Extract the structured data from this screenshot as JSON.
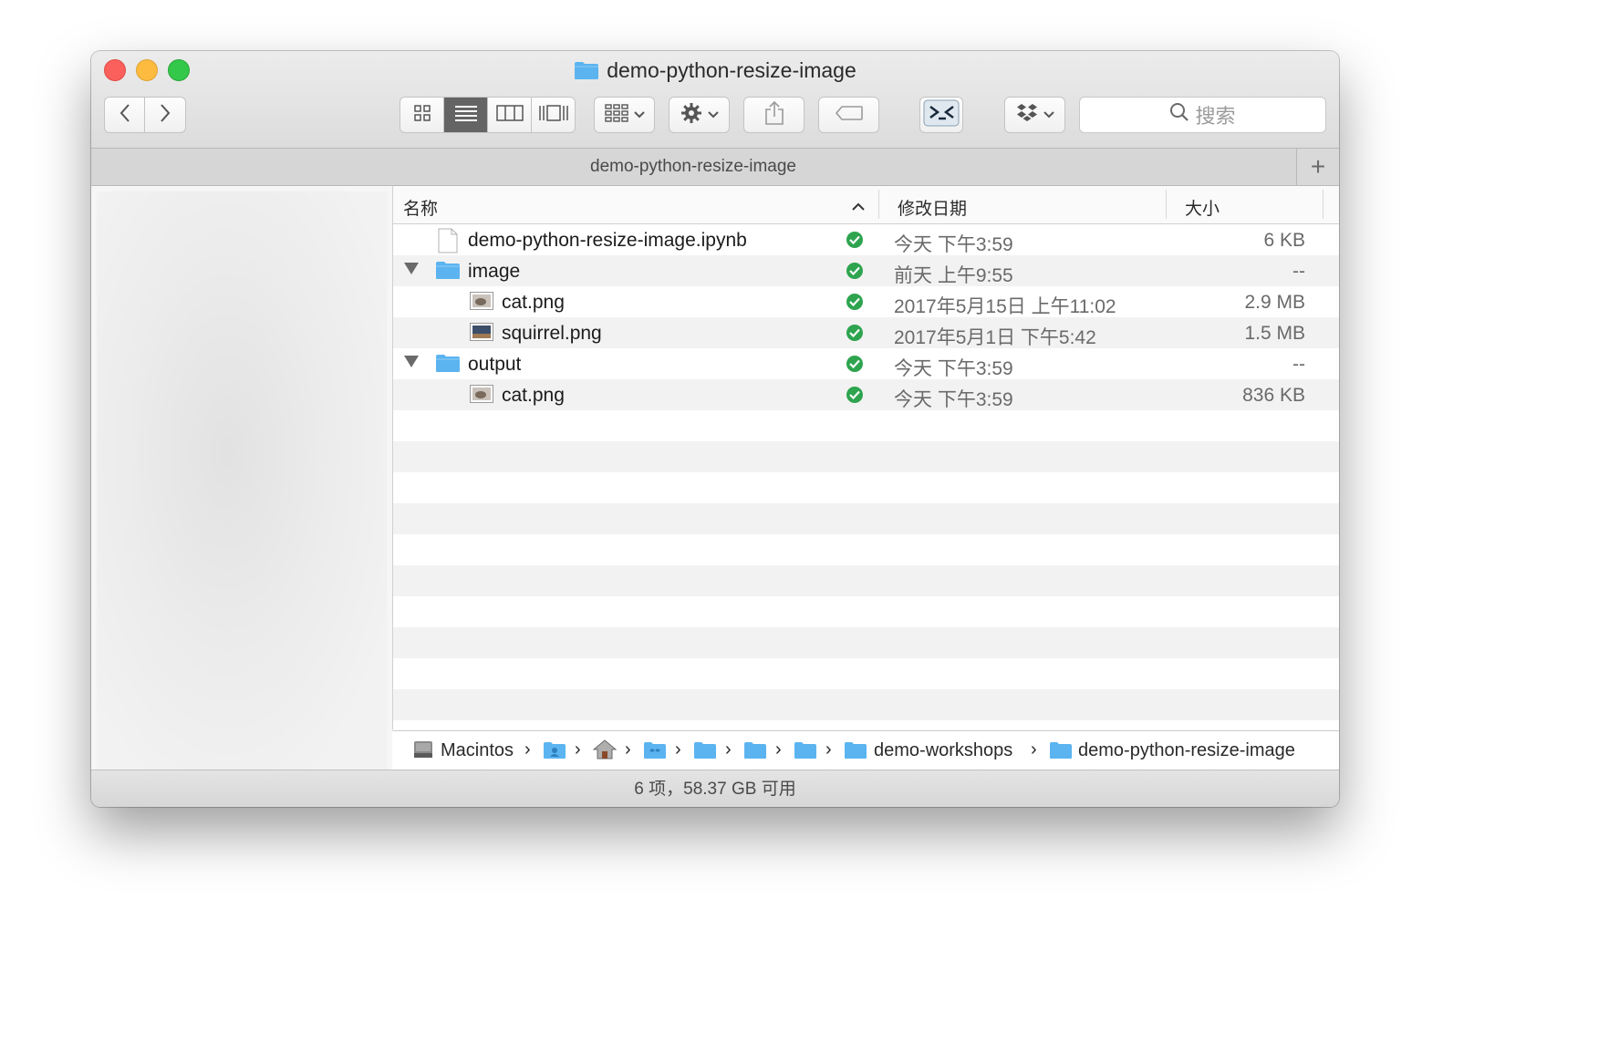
{
  "window": {
    "title": "demo-python-resize-image"
  },
  "toolbar": {
    "search_placeholder": "搜索"
  },
  "tabbar": {
    "title": "demo-python-resize-image",
    "add_label": "+"
  },
  "columns": {
    "name": "名称",
    "date": "修改日期",
    "size": "大小"
  },
  "files": [
    {
      "name": "demo-python-resize-image.ipynb",
      "date": "今天 下午3:59",
      "size": "6 KB",
      "kind": "document",
      "level": 0
    },
    {
      "name": "image",
      "date": "前天 上午9:55",
      "size": "--",
      "kind": "folder",
      "level": 0,
      "expanded": true
    },
    {
      "name": "cat.png",
      "date": "2017年5月15日 上午11:02",
      "size": "2.9 MB",
      "kind": "image",
      "level": 1
    },
    {
      "name": "squirrel.png",
      "date": "2017年5月1日 下午5:42",
      "size": "1.5 MB",
      "kind": "image",
      "level": 1
    },
    {
      "name": "output",
      "date": "今天 下午3:59",
      "size": "--",
      "kind": "folder",
      "level": 0,
      "expanded": true
    },
    {
      "name": "cat.png",
      "date": "今天 下午3:59",
      "size": "836 KB",
      "kind": "image",
      "level": 1
    }
  ],
  "pathbar": {
    "disk": "Macintos",
    "folder1": "demo-workshops",
    "folder2": "demo-python-resize-image"
  },
  "status": {
    "text": "6 项，58.37 GB 可用"
  },
  "colors": {
    "folder": "#5bb4f0",
    "check": "#2ea44f",
    "close": "#fc605c",
    "minimize": "#fdbc40",
    "zoom": "#34c84a"
  }
}
